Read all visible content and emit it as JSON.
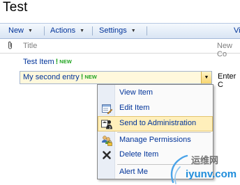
{
  "page": {
    "title": "Test"
  },
  "toolbar": {
    "new_label": "New",
    "actions_label": "Actions",
    "settings_label": "Settings",
    "view_label": "Vi"
  },
  "list": {
    "col_title": "Title",
    "col_new": "New Co",
    "rows": [
      {
        "title": "Test Item",
        "badge": "NEW"
      },
      {
        "title": "My second entry",
        "badge": "NEW"
      }
    ],
    "enter_text": "Enter C"
  },
  "menu": {
    "items": [
      {
        "label": "View Item",
        "icon": "none"
      },
      {
        "label": "Edit Item",
        "icon": "edit-icon"
      },
      {
        "label": "Send to Administration",
        "icon": "workflow-icon"
      },
      {
        "label": "Manage Permissions",
        "icon": "permissions-icon"
      },
      {
        "label": "Delete Item",
        "icon": "delete-icon"
      },
      {
        "label": "Alert Me",
        "icon": "none"
      }
    ],
    "highlighted": "Send to Administration"
  },
  "watermark": {
    "line1": "运维网",
    "line2": "iyunv.com"
  },
  "colors": {
    "link": "#003399",
    "new_badge": "#22a522",
    "highlight": "#ffefbb",
    "toolbar": "#d9e5f4"
  }
}
